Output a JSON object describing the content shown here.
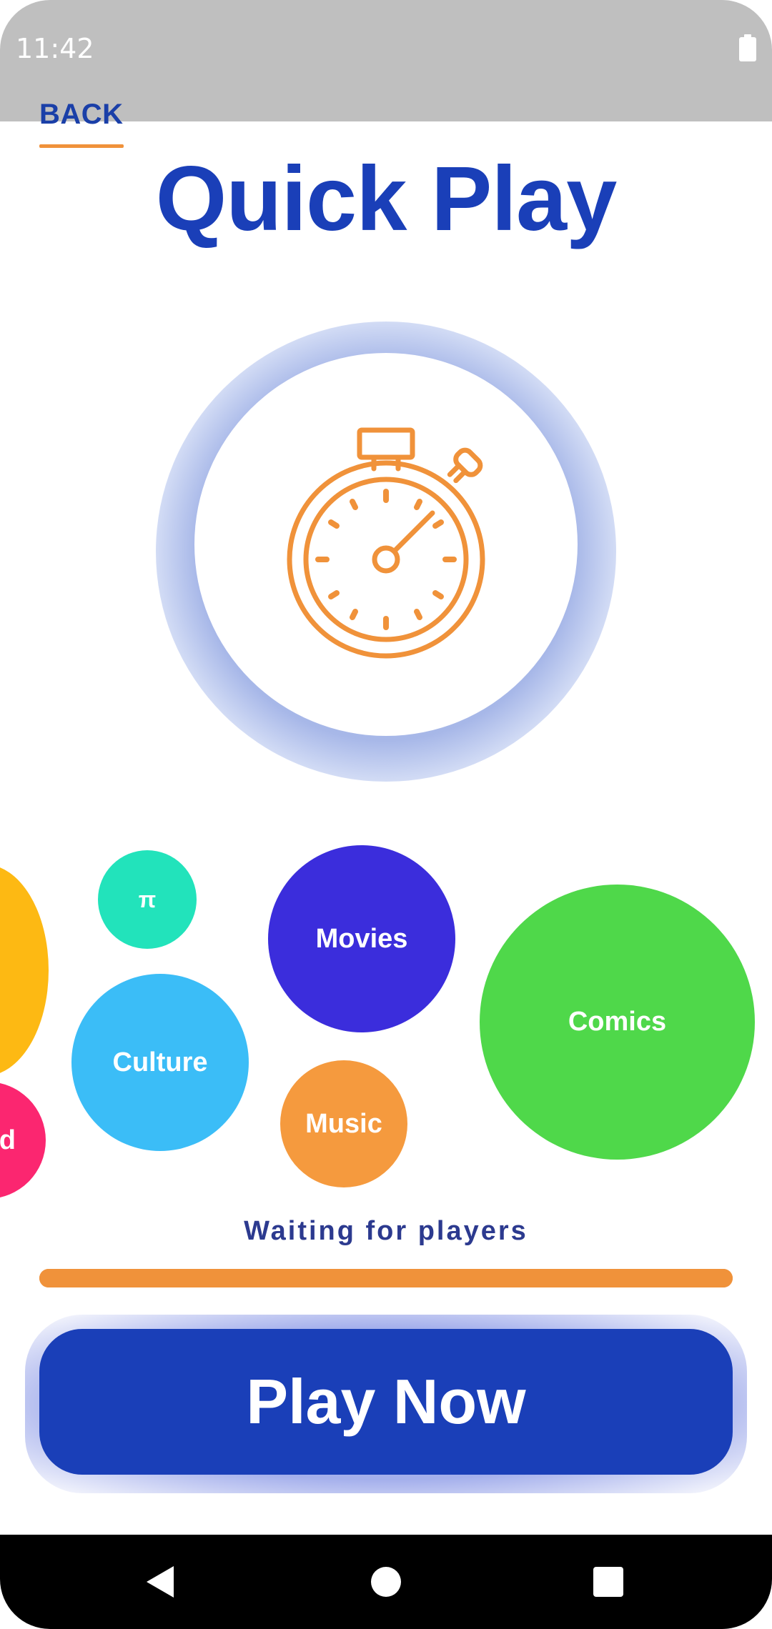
{
  "status_bar": {
    "time": "11:42",
    "battery_icon": "battery-full-icon"
  },
  "header": {
    "back_label": "BACK",
    "title": "Quick Play"
  },
  "timer": {
    "icon": "stopwatch-icon",
    "icon_color": "#f0923a",
    "glow_color": "#8ea4e0"
  },
  "categories": [
    {
      "label": "",
      "color": "#fdb913"
    },
    {
      "label": "π",
      "color": "#22e3bb"
    },
    {
      "label": "Movies",
      "color": "#3b2ddc"
    },
    {
      "label": "Comics",
      "color": "#4fd84a"
    },
    {
      "label": "Culture",
      "color": "#3bbdf7"
    },
    {
      "label": "d",
      "color": "#fb2670"
    },
    {
      "label": "Music",
      "color": "#f59a3e"
    }
  ],
  "status": {
    "waiting_text": "Waiting for players"
  },
  "progress": {
    "value": 1.0,
    "color": "#f0923a"
  },
  "actions": {
    "play_label": "Play Now",
    "play_color": "#1a3fb8"
  },
  "nav_bar": {
    "back_icon": "nav-back-icon",
    "home_icon": "nav-home-icon",
    "recents_icon": "nav-recents-icon"
  }
}
